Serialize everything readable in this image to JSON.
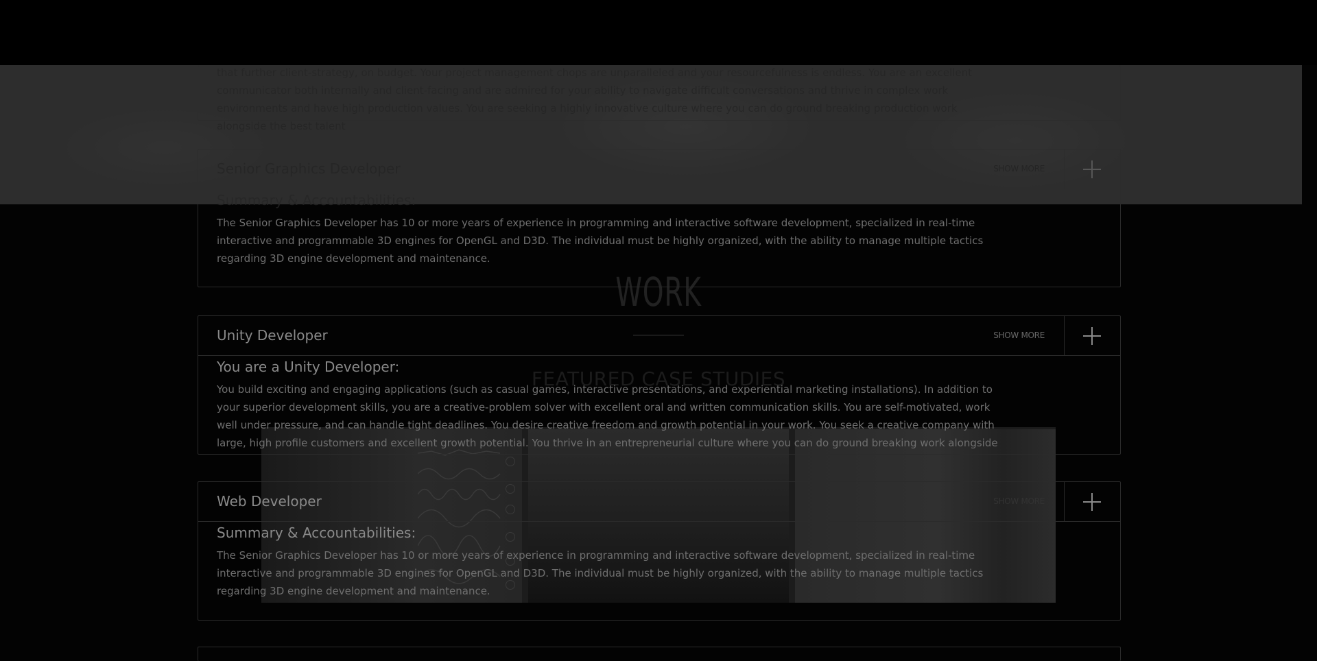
{
  "work": {
    "title": "WORK",
    "featured_title": "FEATURED CASE STUDIES"
  },
  "case_studies": [
    {
      "name": "case-study-1"
    },
    {
      "name": "case-study-2"
    },
    {
      "name": "case-study-3"
    }
  ],
  "jobs": {
    "partial_top": {
      "text": "that further client-strategy, on budget. Your project management chops are unparalleled and your resourcefulness is endless. You are an excellent communicator both internally and client-facing and are admired for your ability to navigate difficult conversations and thrive in complex work environments and have high production values. You are seeking a highly innovative culture where you can do ground breaking production work alongside the best talent"
    },
    "senior_graphics": {
      "title": "Senior Graphics Developer",
      "show_more": "SHOW MORE",
      "heading": "Summary & Accountabilities:",
      "text": "The Senior Graphics Developer has 10 or more years of experience in programming and interactive software development, specialized in real-time interactive and programmable 3D engines for OpenGL and D3D. The individual must be highly organized, with the ability to manage multiple tactics regarding 3D engine development and maintenance."
    },
    "unity": {
      "title": "Unity Developer",
      "show_more": "SHOW MORE",
      "heading": "You are a Unity Developer:",
      "text": "You build exciting and engaging applications (such as casual games, interactive presentations, and experiential marketing installations). In addition to your superior development skills, you are a creative-problem solver with excellent oral and written communication skills. You are self-motivated, work well under pressure, and can handle tight deadlines. You desire creative freedom and growth potential in your work. You seek a creative company with large, high profile customers and excellent growth potential. You thrive in an entrepreneurial culture where you can do ground breaking work alongside the best talent."
    },
    "web": {
      "title": "Web Developer",
      "show_more": "SHOW MORE",
      "heading": "Summary & Accountabilities:",
      "text": "The Senior Graphics Developer has 10 or more years of experience in programming and interactive software development, specialized in real-time interactive and programmable 3D engines for OpenGL and D3D. The individual must be highly organized, with the ability to manage multiple tactics regarding 3D engine development and maintenance."
    }
  }
}
